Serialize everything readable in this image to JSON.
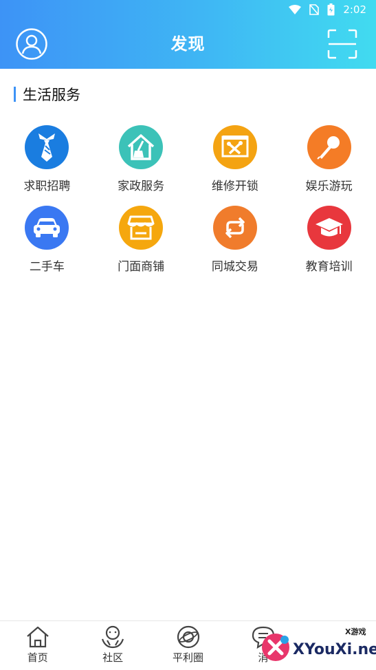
{
  "status_bar": {
    "time": "2:02"
  },
  "header": {
    "title": "发现"
  },
  "section": {
    "title": "生活服务"
  },
  "services": [
    {
      "label": "求职招聘",
      "icon": "tie-icon",
      "color": "#1a7de0"
    },
    {
      "label": "家政服务",
      "icon": "house-broom-icon",
      "color": "#3cc2b8"
    },
    {
      "label": "维修开锁",
      "icon": "tools-icon",
      "color": "#f4a312"
    },
    {
      "label": "娱乐游玩",
      "icon": "microphone-icon",
      "color": "#f47c26"
    },
    {
      "label": "二手车",
      "icon": "car-icon",
      "color": "#3a78f2"
    },
    {
      "label": "门面商铺",
      "icon": "shop-icon",
      "color": "#f5a70e"
    },
    {
      "label": "同城交易",
      "icon": "exchange-icon",
      "color": "#f07c2c"
    },
    {
      "label": "教育培训",
      "icon": "graduation-cap-icon",
      "color": "#e8373d"
    }
  ],
  "tabbar": {
    "items": [
      {
        "label": "首页",
        "icon": "home-icon"
      },
      {
        "label": "社区",
        "icon": "community-icon"
      },
      {
        "label": "平利圈",
        "icon": "circle-planet-icon"
      },
      {
        "label": "消",
        "icon": "message-icon"
      }
    ]
  },
  "watermark": {
    "small": "X游戏",
    "text": "XYouXi.net"
  }
}
